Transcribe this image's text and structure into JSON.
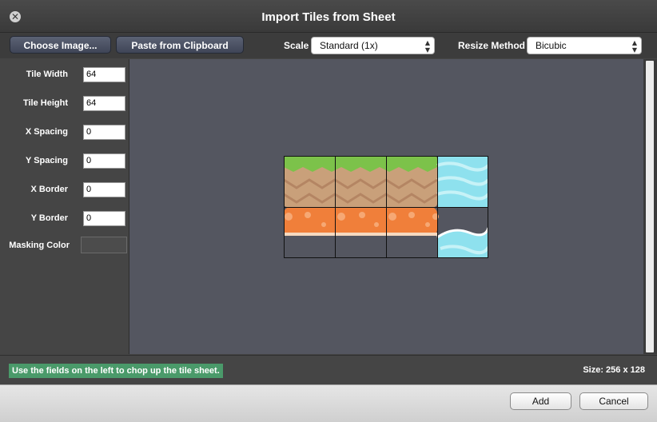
{
  "window": {
    "title": "Import Tiles from Sheet",
    "close_glyph": "✕"
  },
  "toolbar": {
    "choose_image_label": "Choose Image...",
    "paste_label": "Paste from Clipboard",
    "scale_label": "Scale",
    "scale_value": "Standard (1x)",
    "resize_label": "Resize Method",
    "resize_value": "Bicubic"
  },
  "fields": {
    "tile_width": {
      "label": "Tile Width",
      "value": "64"
    },
    "tile_height": {
      "label": "Tile Height",
      "value": "64"
    },
    "x_spacing": {
      "label": "X Spacing",
      "value": "0"
    },
    "y_spacing": {
      "label": "Y Spacing",
      "value": "0"
    },
    "x_border": {
      "label": "X Border",
      "value": "0"
    },
    "y_border": {
      "label": "Y Border",
      "value": "0"
    },
    "masking_color": {
      "label": "Masking Color"
    }
  },
  "status": {
    "hint": "Use the fields on the left to chop up the tile sheet.",
    "size_text": "Size: 256 x 128"
  },
  "footer": {
    "add_label": "Add",
    "cancel_label": "Cancel"
  },
  "colors": {
    "grass": "#7cc24a",
    "dirt": "#c9a07a",
    "dirt_zigzag": "#b48563",
    "lava": "#f07f3a",
    "lava_bubble": "#f6a874",
    "water": "#8ee1ee",
    "water_wave": "#c6f2f7"
  }
}
